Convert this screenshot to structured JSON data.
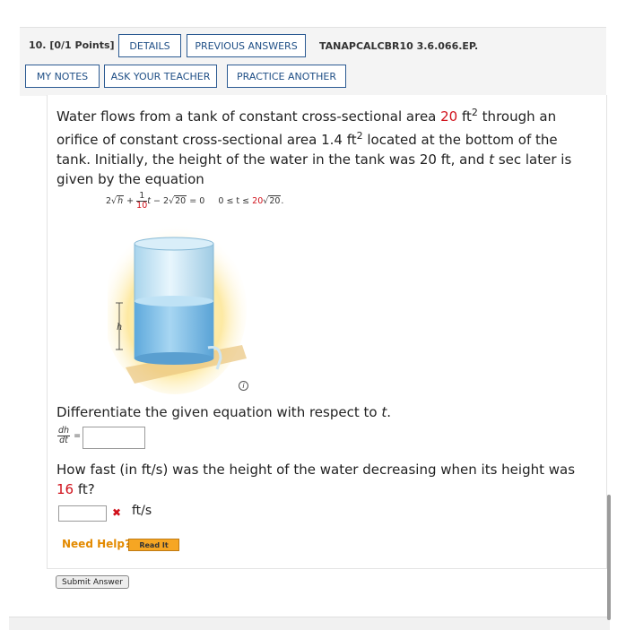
{
  "header": {
    "question_number": "10.",
    "points": "[0/1 Points]",
    "details_label": "DETAILS",
    "previous_answers_label": "PREVIOUS ANSWERS",
    "problem_code": "TANAPCALCBR10 3.6.066.EP.",
    "my_notes_label": "MY NOTES",
    "ask_teacher_label": "ASK YOUR TEACHER",
    "practice_another_label": "PRACTICE ANOTHER"
  },
  "problem": {
    "line1_a": "Water flows from a tank of constant cross-sectional area ",
    "area_value": "20",
    "line1_b": " ft",
    "line1_exp": "2",
    "line1_c": " through an",
    "line2_a": "orifice of constant cross-sectional area 1.4 ft",
    "line2_exp": "2",
    "line2_b": " located at the bottom of the",
    "line3_a": "tank. Initially, the height of the water in the tank was 20 ft, and ",
    "line3_t": "t",
    "line3_b": " sec later is",
    "line4": "given by the equation",
    "eq": {
      "two": "2",
      "h": "h",
      "plus": "+",
      "num": "1",
      "den": "10",
      "t": "t",
      "minus": "− 2",
      "twenty": "20",
      "equals": "= 0",
      "range_a": "0 ≤ t ≤ ",
      "range_red": "20",
      "range_sqrt": "20",
      "range_end": "."
    },
    "figure_label": "h",
    "info_icon": "i"
  },
  "part1": {
    "prompt_a": "Differentiate the given equation with respect to ",
    "prompt_t": "t",
    "prompt_end": ".",
    "lhs_num": "dh",
    "lhs_den": "dt",
    "lhs_eq": "=",
    "value": ""
  },
  "part2": {
    "prompt_a": "How fast (in ft/s) was the height of the water decreasing when its height was",
    "height_value": "16",
    "prompt_b": " ft?",
    "value": "",
    "wrong_icon": "✖",
    "unit": "ft/s"
  },
  "help": {
    "label": "Need Help?",
    "read_it": "Read It"
  },
  "submit_label": "Submit Answer",
  "colors": {
    "accent": "#1f4f86",
    "incorrect": "#d0101a",
    "help": "#e38a00"
  }
}
